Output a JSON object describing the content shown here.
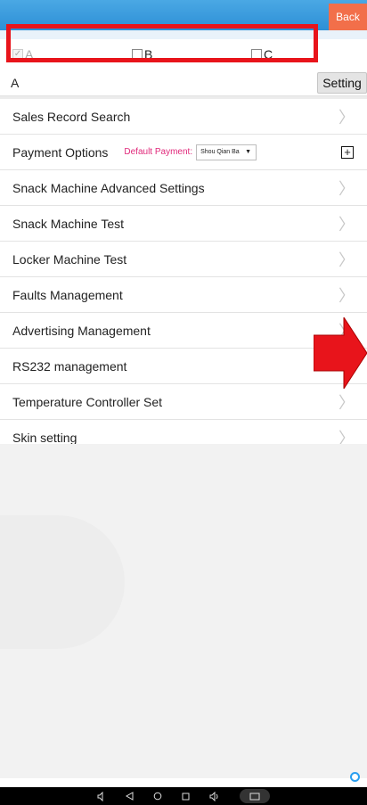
{
  "header": {
    "back_label": "Back"
  },
  "checkboxes": [
    {
      "label": "A",
      "checked": true,
      "disabled": true
    },
    {
      "label": "B",
      "checked": false,
      "disabled": false
    },
    {
      "label": "C",
      "checked": false,
      "disabled": false
    }
  ],
  "selected_row": {
    "label": "A",
    "setting_label": "Setting"
  },
  "menu": {
    "sales_record_search": "Sales Record Search",
    "payment_options": "Payment Options",
    "default_payment_label": "Default Payment:",
    "default_payment_value": "Shou Qian Ba",
    "snack_advanced": "Snack Machine Advanced Settings",
    "snack_test": "Snack Machine Test",
    "locker_test": "Locker Machine Test",
    "faults": "Faults Management",
    "advertising": "Advertising Management",
    "rs232": "RS232 management",
    "temperature": "Temperature Controller Set",
    "skin": "Skin setting"
  },
  "colors": {
    "top_bar": "#2d8fd6",
    "back_button": "#f26f4a",
    "highlight_box": "#e8141b",
    "arrow": "#e8141b",
    "default_payment_text": "#e0287a"
  },
  "icons": {
    "chevron": "chevron-right-icon",
    "plus": "plus-square-icon",
    "refresh": "refresh-icon",
    "nav_volume_down": "volume-down-icon",
    "nav_back": "nav-back-icon",
    "nav_home": "nav-home-icon",
    "nav_recents": "nav-recents-icon",
    "nav_volume_up": "volume-up-icon",
    "nav_screenshot": "screenshot-icon"
  }
}
